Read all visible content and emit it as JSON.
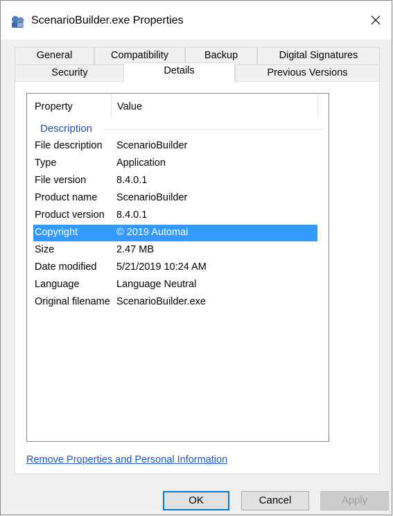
{
  "window": {
    "title": "ScenarioBuilder.exe Properties",
    "close_glyph": "✕"
  },
  "tabs": {
    "row1": [
      "General",
      "Compatibility",
      "Backup",
      "Digital Signatures"
    ],
    "row2": [
      "Security",
      "Details",
      "Previous Versions"
    ],
    "active": "Details"
  },
  "list": {
    "headers": {
      "property": "Property",
      "value": "Value"
    },
    "group": "Description",
    "rows": [
      {
        "property": "File description",
        "value": "ScenarioBuilder"
      },
      {
        "property": "Type",
        "value": "Application"
      },
      {
        "property": "File version",
        "value": "8.4.0.1"
      },
      {
        "property": "Product name",
        "value": "ScenarioBuilder"
      },
      {
        "property": "Product version",
        "value": "8.4.0.1"
      },
      {
        "property": "Copyright",
        "value": "© 2019 Automai"
      },
      {
        "property": "Size",
        "value": "2.47 MB"
      },
      {
        "property": "Date modified",
        "value": "5/21/2019 10:24 AM"
      },
      {
        "property": "Language",
        "value": "Language Neutral"
      },
      {
        "property": "Original filename",
        "value": "ScenarioBuilder.exe"
      }
    ],
    "selected_row": "Copyright"
  },
  "link": {
    "label": "Remove Properties and Personal Information"
  },
  "buttons": {
    "ok": "OK",
    "cancel": "Cancel",
    "apply": "Apply"
  },
  "colors": {
    "selection": "#3399ff",
    "link": "#1a56c4",
    "group": "#2b4c9f"
  }
}
